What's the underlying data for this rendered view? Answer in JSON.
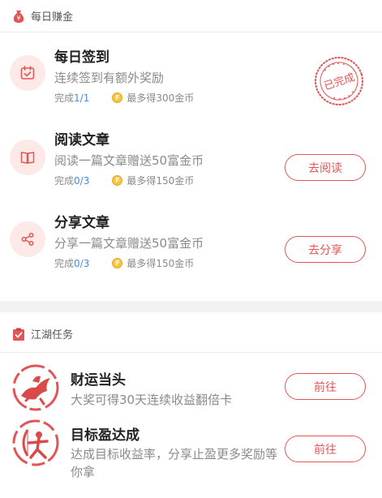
{
  "daily": {
    "header": "每日赚金",
    "items": [
      {
        "title": "每日签到",
        "desc": "连续签到有额外奖励",
        "progress_label": "完成",
        "progress_value": "1/1",
        "reward": "最多得300金币",
        "status": "已完成",
        "icon": "calendar-check-icon"
      },
      {
        "title": "阅读文章",
        "desc": "阅读一篇文章赠送50富金币",
        "progress_label": "完成",
        "progress_value": "0/3",
        "reward": "最多得150金币",
        "button": "去阅读",
        "icon": "book-icon"
      },
      {
        "title": "分享文章",
        "desc": "分享一篇文章赠送50富金币",
        "progress_label": "完成",
        "progress_value": "0/3",
        "reward": "最多得150金币",
        "button": "去分享",
        "icon": "share-icon"
      }
    ]
  },
  "jianghu": {
    "header": "江湖任务",
    "items": [
      {
        "title": "财运当头",
        "desc": "大奖可得30天连续收益翻倍卡",
        "button": "前往",
        "icon": "horseman-ink-icon"
      },
      {
        "title": "目标盈达成",
        "desc": "达成目标收益率，分享止盈更多奖励等你拿",
        "button": "前往",
        "icon": "archer-ink-icon"
      }
    ]
  },
  "colors": {
    "accent": "#e05656",
    "progress_blue": "#4a8bd8",
    "icon_bg": "#fde9e7"
  }
}
